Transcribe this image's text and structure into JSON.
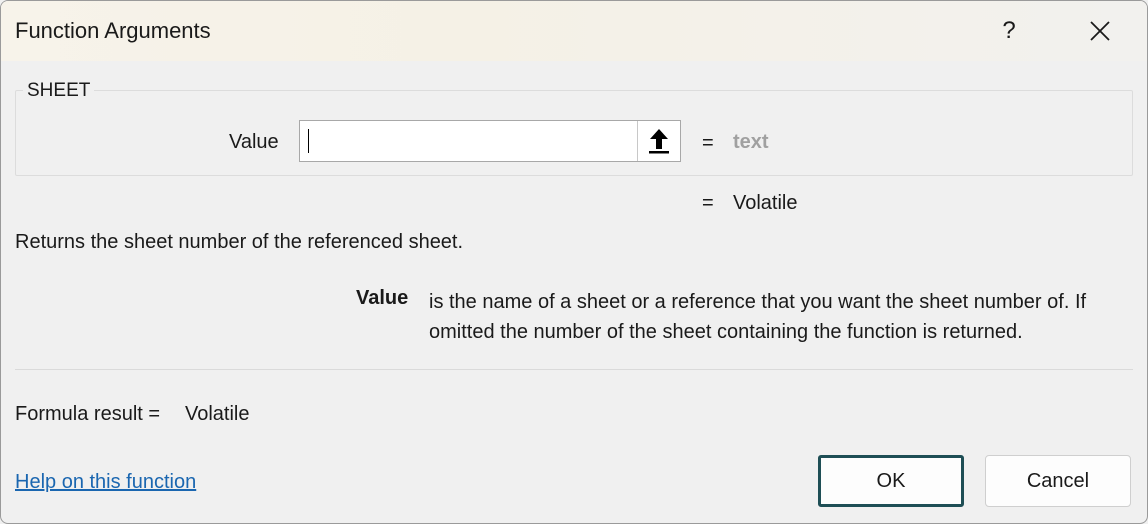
{
  "window": {
    "title": "Function Arguments",
    "help_icon": "?",
    "close_icon": "close-icon"
  },
  "function": {
    "name": "SHEET",
    "argument": {
      "label": "Value",
      "value": "",
      "collapse_icon": "up-arrow-icon",
      "equals": "=",
      "result": "text"
    },
    "result_equals": "=",
    "result": "Volatile",
    "description": "Returns the sheet number of the referenced sheet.",
    "argument_help": {
      "name": "Value",
      "text": "is the name of a sheet or a reference that you want the sheet number of.  If omitted the number of the sheet containing the function is returned."
    }
  },
  "formula_result": {
    "label": "Formula result =",
    "value": "Volatile"
  },
  "help_link": "Help on this function",
  "buttons": {
    "ok": "OK",
    "cancel": "Cancel"
  },
  "colors": {
    "link": "#1a66b0",
    "ok_border": "#1e4e55",
    "placeholder_result": "#a0a0a0"
  }
}
